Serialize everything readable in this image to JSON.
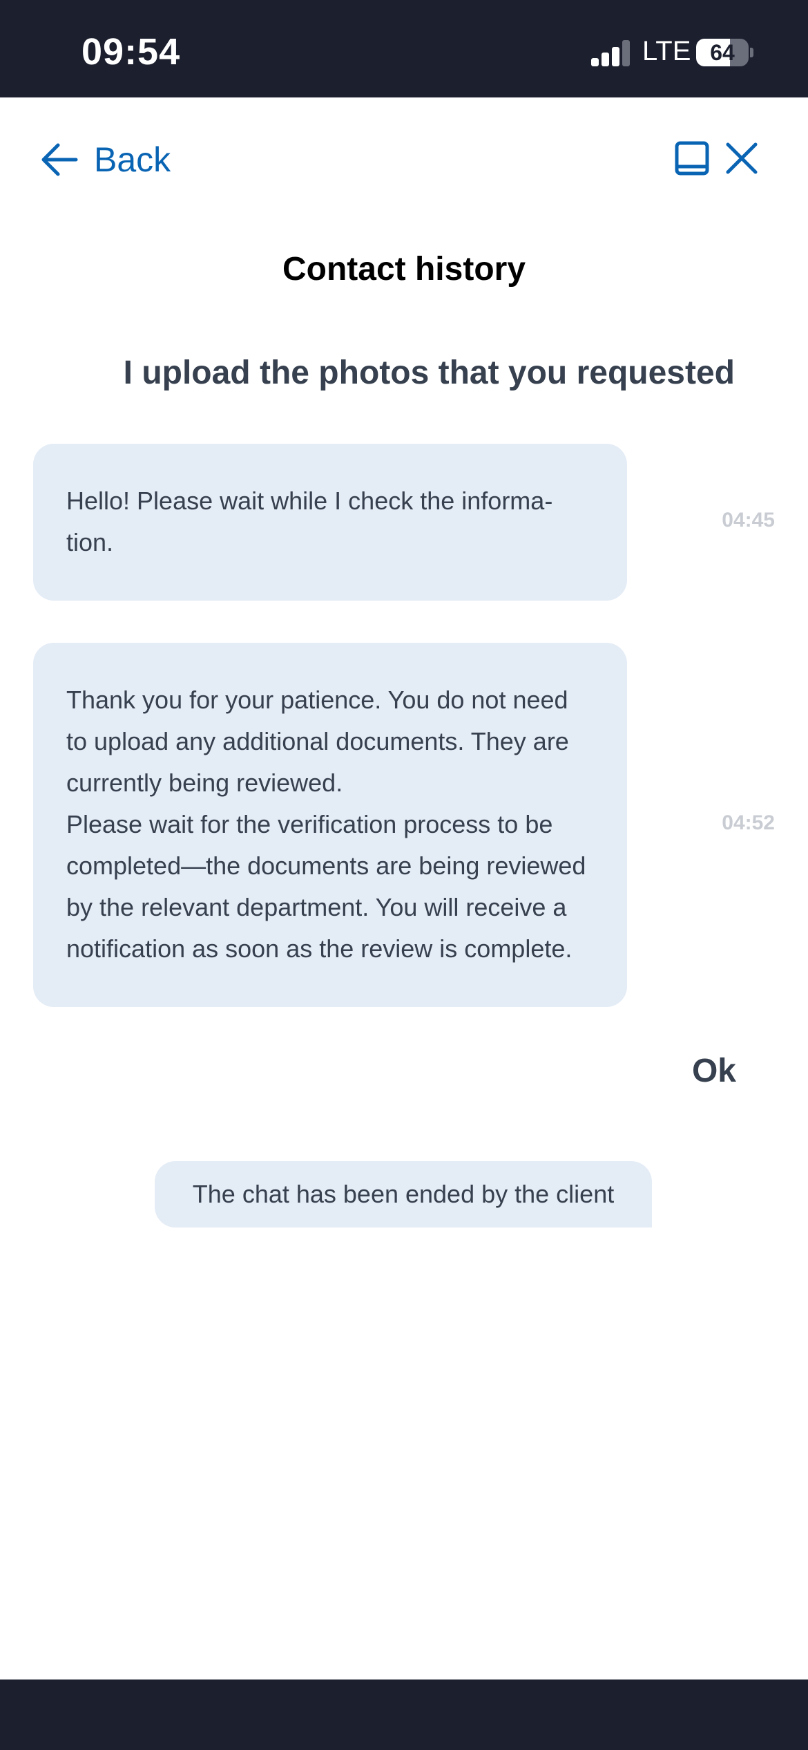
{
  "status_bar": {
    "time": "09:54",
    "network": "LTE",
    "battery_level": "64",
    "battery_fraction": 0.64,
    "signal_bars_active": 3,
    "signal_bars_total": 4
  },
  "nav": {
    "back_label": "Back",
    "minimize_icon": "minimize-icon",
    "close_icon": "close-icon",
    "accent_color": "#0a64b4"
  },
  "page": {
    "title": "Contact history"
  },
  "messages": [
    {
      "sender": "user",
      "text": "I upload the photos that you requested"
    },
    {
      "sender": "agent",
      "lines": [
        "Hello! Please wait while I check the informa-",
        "tion."
      ],
      "time": "04:45"
    },
    {
      "sender": "agent",
      "lines": [
        "Thank you for your patience. You do not need",
        "to upload any additional documents. They are",
        "currently being reviewed.",
        "Please wait for the verification process to be",
        "completed—the documents are being reviewed",
        "by the relevant department. You will receive a",
        "notification as soon as the review is complete."
      ],
      "time": "04:52"
    },
    {
      "sender": "user",
      "text": "Ok"
    }
  ],
  "system_notice": "The chat has been ended by the client",
  "colors": {
    "header_bg": "#1c1f2e",
    "bubble_bg": "#e4ecf6",
    "text": "#36404e",
    "timestamp": "#c9cdd3"
  }
}
